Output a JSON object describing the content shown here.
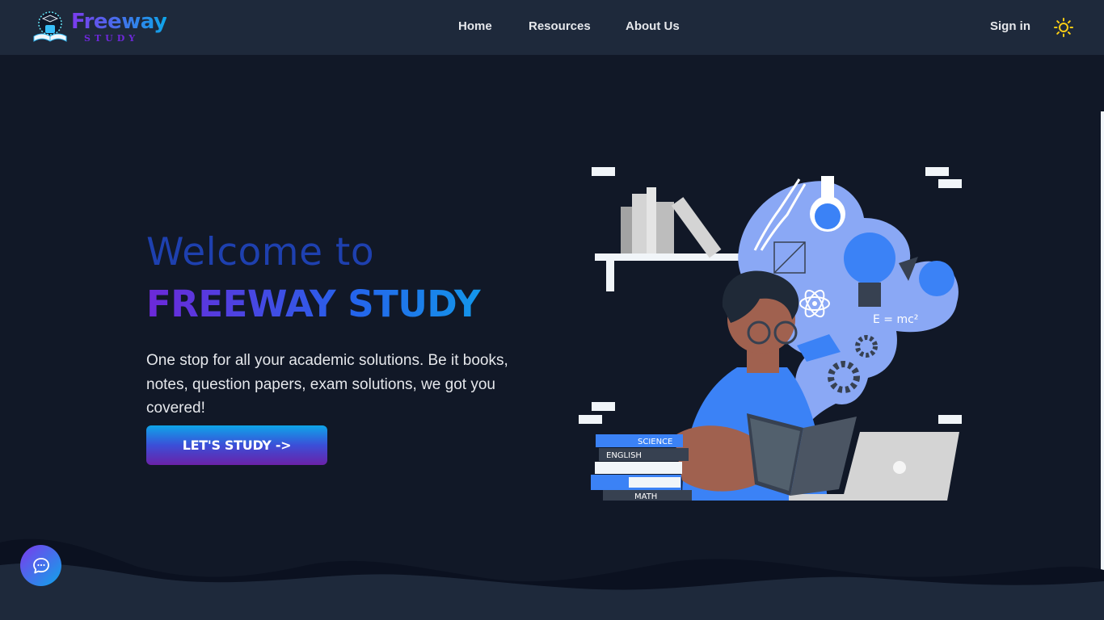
{
  "logo": {
    "main": "Freeway",
    "sub": "STUDY"
  },
  "nav": {
    "home": "Home",
    "resources": "Resources",
    "about": "About Us"
  },
  "auth": {
    "signin": "Sign in"
  },
  "icons": {
    "theme": "sun-icon",
    "chat": "chat-bubble-icon"
  },
  "hero": {
    "welcome": "Welcome to",
    "brand": "FREEWAY STUDY",
    "tagline": "One stop for all your academic solutions. Be it books, notes, question papers, exam solutions, we got you covered!",
    "cta": "LET'S STUDY ->"
  },
  "illustration": {
    "book_labels": [
      "SCIENCE",
      "ENGLISH",
      "MATH"
    ],
    "formula": "E = mc²"
  },
  "colors": {
    "background": "#111827",
    "navbar": "#1e293b",
    "accent_blue": "#3b82f6",
    "accent_purple": "#6d28d9",
    "accent_cyan": "#0ea5e9",
    "sun": "#facc15"
  }
}
